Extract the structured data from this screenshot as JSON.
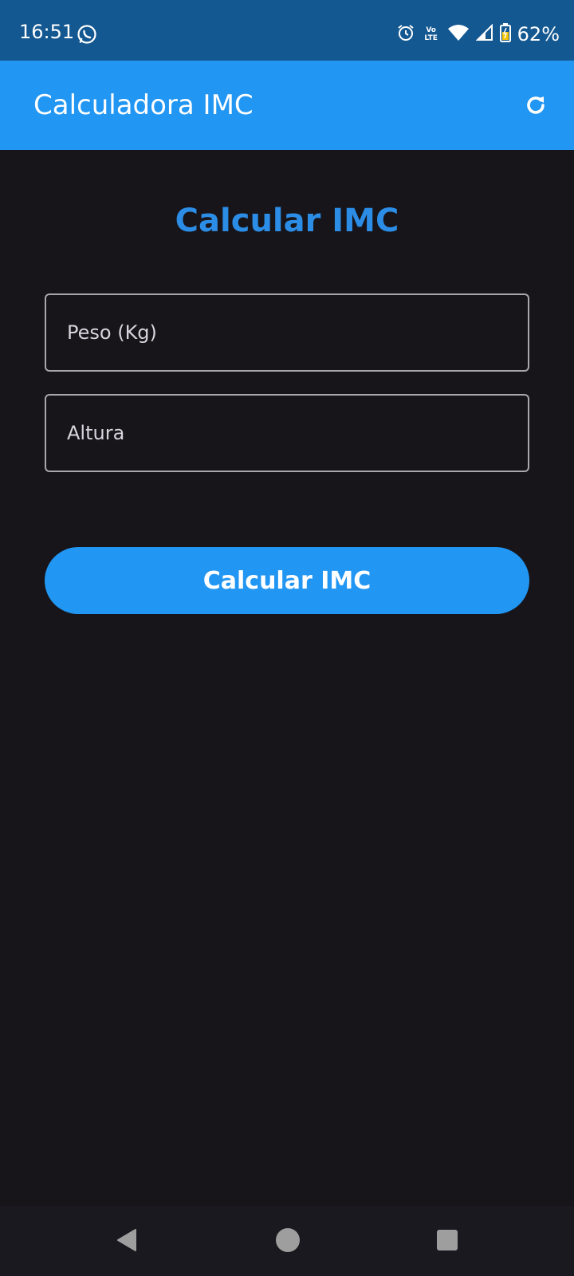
{
  "status_bar": {
    "time": "16:51",
    "volte_line1": "Vo",
    "volte_line2": "LTE",
    "battery_percent": "62%",
    "icons": [
      "whatsapp-icon",
      "alarm-icon",
      "volte-icon",
      "wifi-icon",
      "signal-icon",
      "battery-icon"
    ]
  },
  "app_bar": {
    "title": "Calculadora IMC",
    "refresh_icon": "refresh-icon"
  },
  "main": {
    "heading": "Calcular IMC",
    "peso_placeholder": "Peso (Kg)",
    "altura_placeholder": "Altura",
    "calculate_label": "Calcular IMC"
  },
  "colors": {
    "status_bar": "#145891",
    "app_bar": "#2196f3",
    "background": "#17151a",
    "heading": "#2c8de6",
    "button": "#2196f3"
  },
  "nav_bar": {
    "icons": [
      "back-icon",
      "home-icon",
      "recents-icon"
    ]
  }
}
